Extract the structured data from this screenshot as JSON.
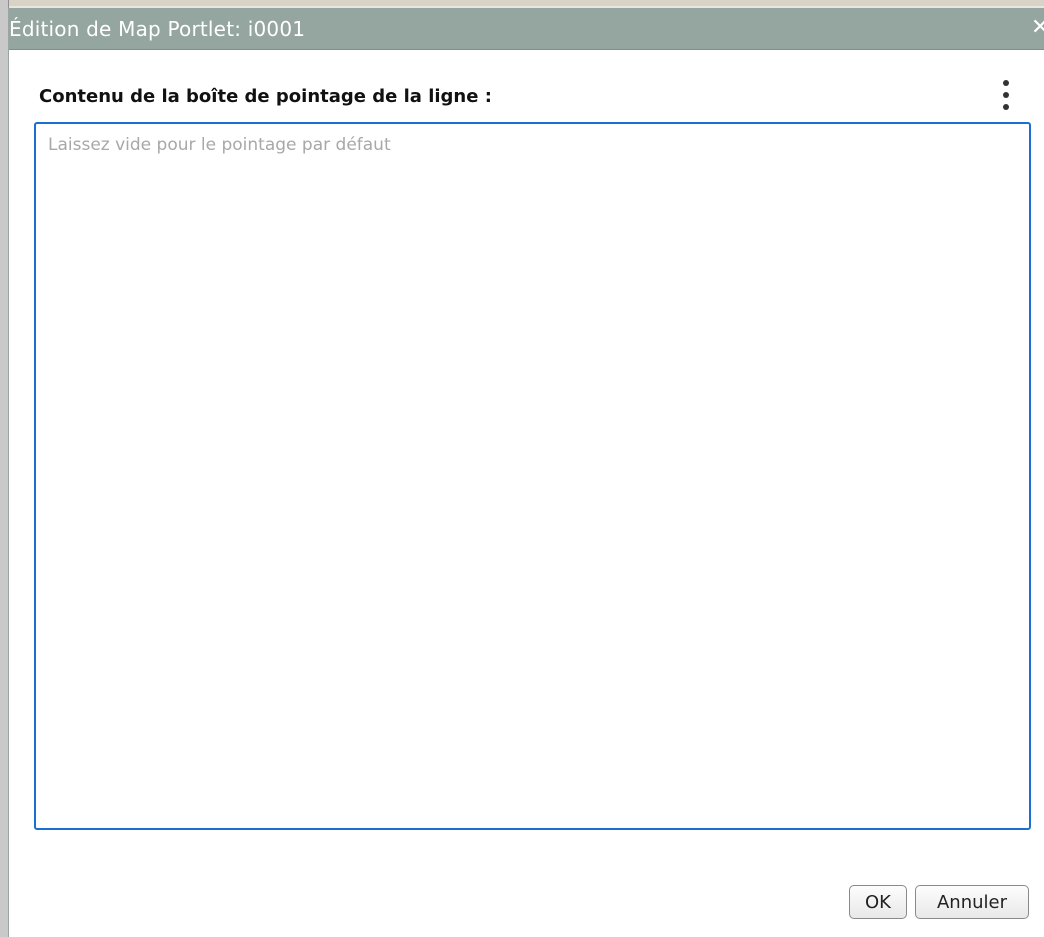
{
  "dialog": {
    "title": "Édition de Map Portlet: i0001",
    "close_icon": "close-icon"
  },
  "form": {
    "label": "Contenu de la boîte de pointage de la ligne :",
    "menu_icon": "kebab-menu-icon",
    "textarea": {
      "value": "",
      "placeholder": "Laissez vide pour le pointage par défaut"
    }
  },
  "buttons": {
    "ok_label": "OK",
    "cancel_label": "Annuler"
  },
  "colors": {
    "titlebar": "#95a5a0",
    "focus_border": "#1b6fd1"
  }
}
